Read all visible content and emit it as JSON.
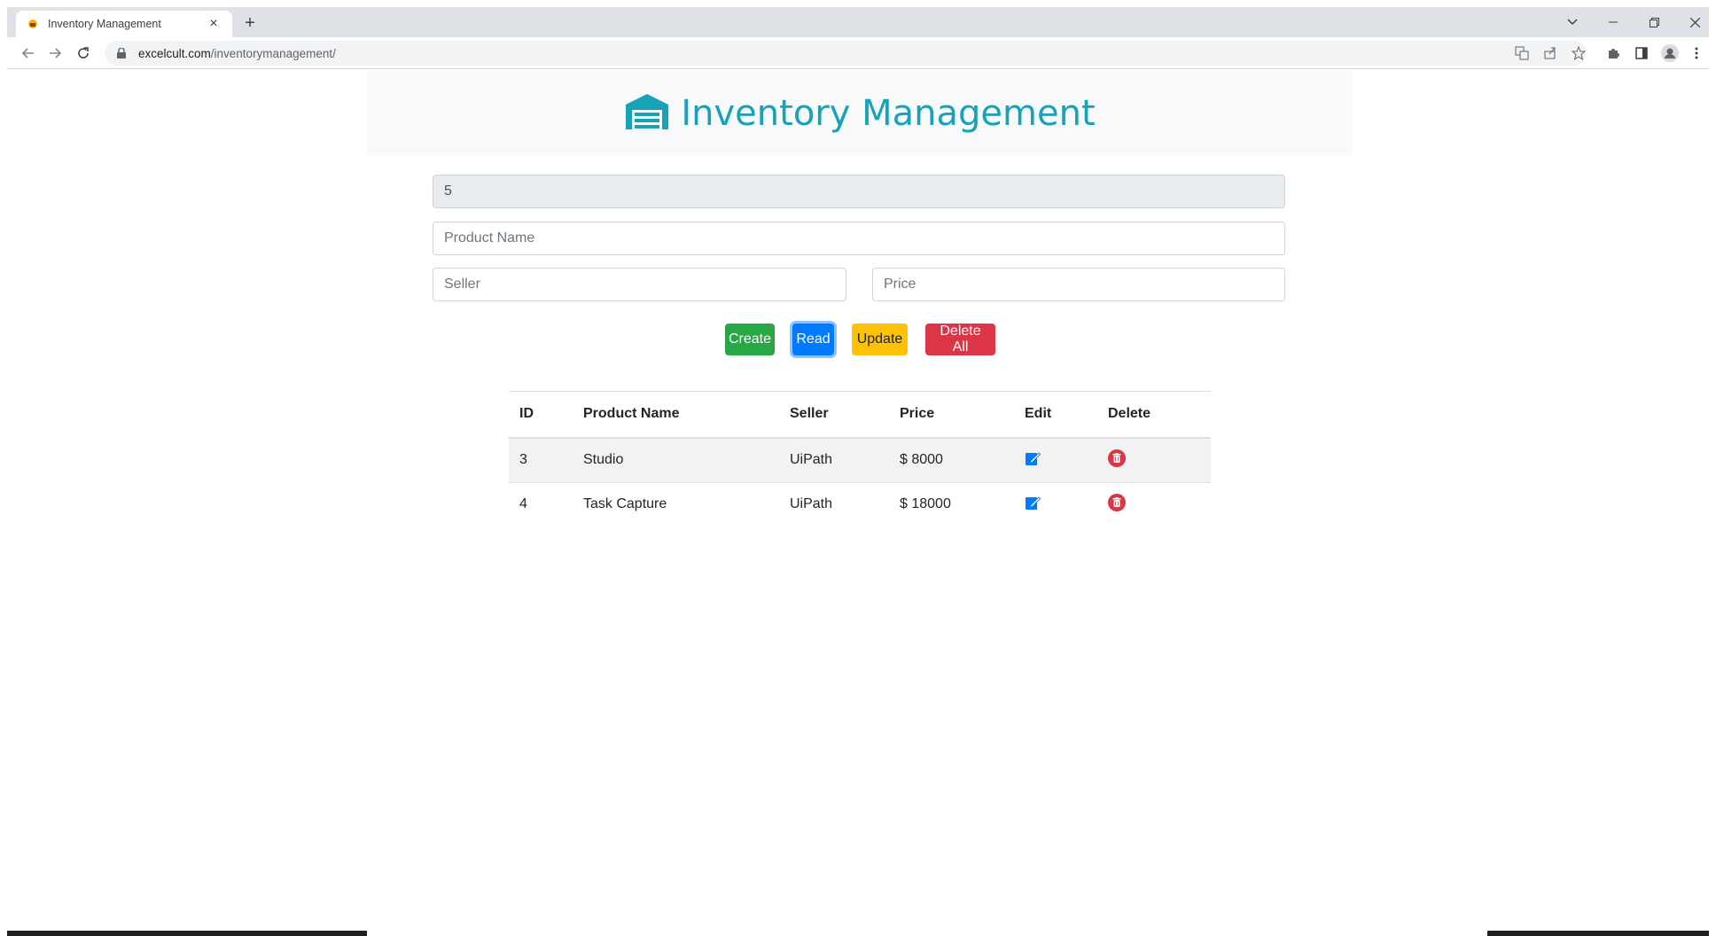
{
  "browser": {
    "tab_title": "Inventory Management",
    "new_tab_label": "+",
    "url_host": "excelcult.com",
    "url_path": "/inventorymanagement/"
  },
  "header": {
    "title": "Inventory Management",
    "icon": "warehouse-icon",
    "color": "#17a2b8"
  },
  "form": {
    "id_value": "5",
    "product_name_placeholder": "Product Name",
    "seller_placeholder": "Seller",
    "price_placeholder": "Price"
  },
  "buttons": {
    "create": "Create",
    "read": "Read",
    "update": "Update",
    "delete_all": "Delete All"
  },
  "table": {
    "columns": [
      "ID",
      "Product Name",
      "Seller",
      "Price",
      "Edit",
      "Delete"
    ],
    "rows": [
      {
        "id": "3",
        "product": "Studio",
        "seller": "UiPath",
        "price": "$ 8000"
      },
      {
        "id": "4",
        "product": "Task Capture",
        "seller": "UiPath",
        "price": "$ 18000"
      }
    ]
  }
}
